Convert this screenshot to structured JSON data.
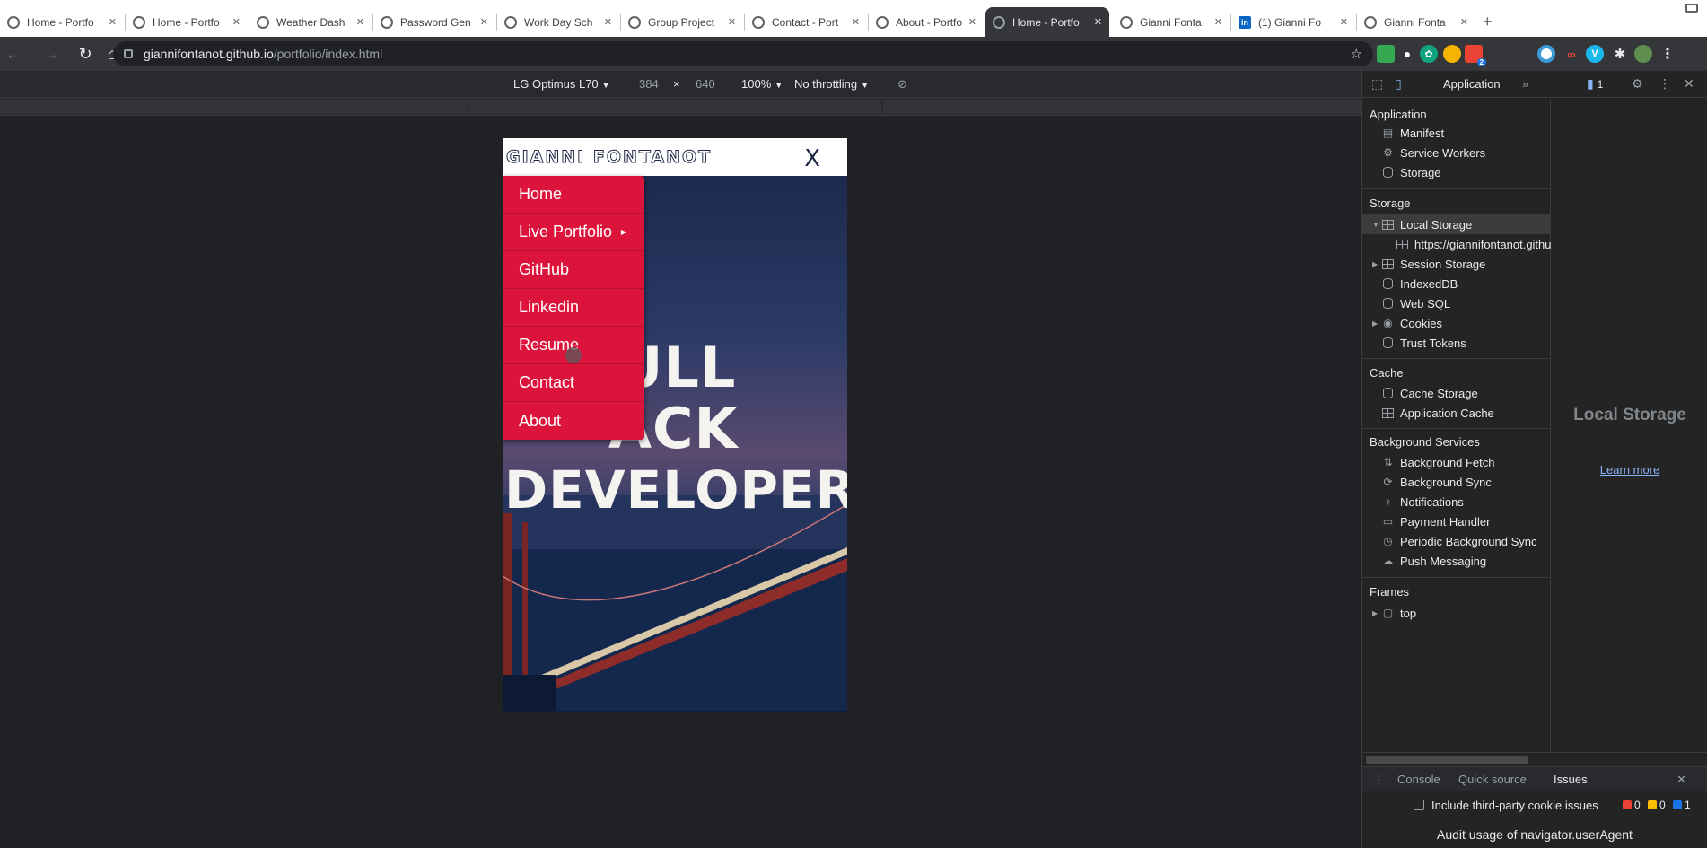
{
  "browser": {
    "tabs": [
      {
        "title": "Home - Portfo",
        "active": false
      },
      {
        "title": "Home - Portfo",
        "active": false
      },
      {
        "title": "Weather Dash",
        "active": false
      },
      {
        "title": "Password Gen",
        "active": false
      },
      {
        "title": "Work Day Sch",
        "active": false
      },
      {
        "title": "Group Project",
        "active": false
      },
      {
        "title": "Contact - Port",
        "active": false
      },
      {
        "title": "About - Portfo",
        "active": false
      },
      {
        "title": "Home - Portfo",
        "active": true
      },
      {
        "title": "Gianni Fonta",
        "active": false
      },
      {
        "title": "(1) Gianni Fo",
        "active": false
      },
      {
        "title": "Gianni Fonta",
        "active": false
      }
    ],
    "close_glyph": "✕",
    "url_host": "giannifontanot.github.io",
    "url_path": "/portfolio/index.html",
    "notification_badge": "2",
    "extensions": [
      "V"
    ]
  },
  "device_toolbar": {
    "device": "LG Optimus L70",
    "width": "384",
    "times": "×",
    "height": "640",
    "zoom": "100%",
    "throttling": "No throttling"
  },
  "site": {
    "logo": "GIANNI FONTANOT",
    "close": "X",
    "hero_lines": [
      "ULL",
      "ACK",
      "DEVELOPER"
    ],
    "menu": [
      {
        "label": "Home",
        "submenu": false
      },
      {
        "label": "Live Portfolio",
        "submenu": true
      },
      {
        "label": "GitHub",
        "submenu": false
      },
      {
        "label": "Linkedin",
        "submenu": false
      },
      {
        "label": "Resume",
        "submenu": false
      },
      {
        "label": "Contact",
        "submenu": false
      },
      {
        "label": "About",
        "submenu": false
      }
    ]
  },
  "devtools": {
    "panel": "Application",
    "more": "»",
    "issue_count": "1",
    "sections": {
      "application": {
        "title": "Application",
        "items": [
          "Manifest",
          "Service Workers",
          "Storage"
        ]
      },
      "storage": {
        "title": "Storage",
        "items": [
          "Local Storage",
          "https://giannifontanot.github.io",
          "Session Storage",
          "IndexedDB",
          "Web SQL",
          "Cookies",
          "Trust Tokens"
        ]
      },
      "cache": {
        "title": "Cache",
        "items": [
          "Cache Storage",
          "Application Cache"
        ]
      },
      "background": {
        "title": "Background Services",
        "items": [
          "Background Fetch",
          "Background Sync",
          "Notifications",
          "Payment Handler",
          "Periodic Background Sync",
          "Push Messaging"
        ]
      },
      "frames": {
        "title": "Frames",
        "items": [
          "top"
        ]
      }
    },
    "main_heading": "Local Storage",
    "learn_more": "Learn more",
    "drawer": {
      "tabs": [
        "Console",
        "Quick source",
        "Issues"
      ],
      "checkbox_label": "Include third-party cookie issues",
      "errors": "0",
      "warnings": "0",
      "infos": "1",
      "audit_text": "Audit usage of navigator.userAgent"
    },
    "colors": {
      "error": "#ea4335",
      "warning": "#fbbc04",
      "info": "#1a73e8"
    }
  }
}
